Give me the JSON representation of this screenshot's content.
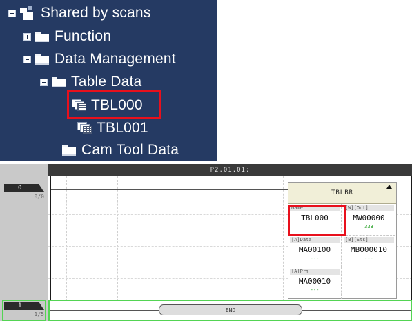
{
  "tree": {
    "root": "Shared by scans",
    "function": "Function",
    "data_management": "Data Management",
    "table_data": "Table Data",
    "tbl000": "TBL000",
    "tbl001": "TBL001",
    "cam_tool_data": "Cam Tool Data"
  },
  "ladder": {
    "header_title": "P2.01.01:",
    "step0_num": "0",
    "step0_sub": "0/0",
    "step1_num": "1",
    "step1_sub": "1/5",
    "end_label": "END",
    "block": {
      "title": "TBLBR",
      "cells": [
        {
          "tag": "Name",
          "value": "TBL000",
          "sub": ""
        },
        {
          "tag": "[W][Out]",
          "value": "MW00000",
          "sub": "333"
        },
        {
          "tag": "[A]Data",
          "value": "MA00100",
          "sub": "---"
        },
        {
          "tag": "[B][Sts]",
          "value": "MB000010",
          "sub": "---"
        },
        {
          "tag": "[A]Prm",
          "value": "MA00010",
          "sub": "---"
        }
      ]
    }
  },
  "colors": {
    "tree_bg": "#253a63",
    "highlight_red": "#e8101c",
    "highlight_green": "#54d454",
    "block_header": "#f1efd8"
  }
}
